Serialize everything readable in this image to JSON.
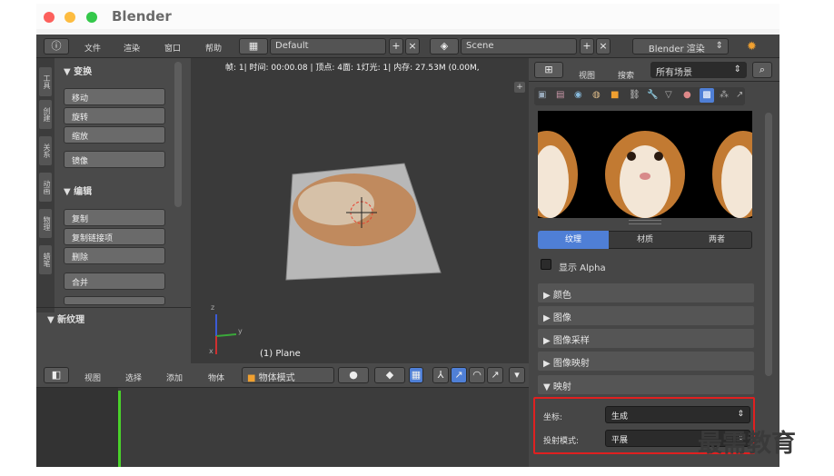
{
  "window": {
    "title": "Blender"
  },
  "infobar": {
    "menus": [
      "文件",
      "渲染",
      "窗口",
      "帮助"
    ],
    "screen_layout": "Default",
    "scene": "Scene",
    "render_engine": "Blender 渲染"
  },
  "toolshelf": {
    "tabs": [
      "工具",
      "创建",
      "关系",
      "动画",
      "物理",
      "蜡笔"
    ],
    "transform_header": "▼ 变换",
    "transform_buttons": [
      "移动",
      "旋转",
      "缩放"
    ],
    "mirror_button": "镜像",
    "edit_header": "▼ 编辑",
    "edit_buttons": [
      "复制",
      "复制链接项",
      "删除"
    ],
    "join_button": "合并",
    "new_texture_header": "▼ 新纹理"
  },
  "viewport": {
    "info": "帧: 1| 时间: 00:00.08 | 顶点: 4面: 1灯光: 1| 内存: 27.53M (0.00M,",
    "object_label": "(1) Plane",
    "axis_labels": {
      "z": "z",
      "y": "y",
      "x": "x"
    }
  },
  "timeline_header": {
    "menus": [
      "视图",
      "选择",
      "添加",
      "物体"
    ],
    "mode": "物体模式"
  },
  "properties": {
    "view_menu": "视图",
    "search_label": "搜索",
    "filter": "所有场景",
    "tabs": [
      "纹理",
      "材质",
      "两者"
    ],
    "show_alpha": "显示 Alpha",
    "sections": [
      "▶ 颜色",
      "▶ 图像",
      "▶ 图像采样",
      "▶ 图像映射"
    ],
    "mapping_header": "▼ 映射",
    "coordinates_label": "坐标:",
    "coordinates_value": "生成",
    "projection_label": "投射模式:",
    "projection_value": "平展"
  },
  "watermark": "最需教育",
  "colors": {
    "accent_blue": "#4f7fd6",
    "highlight_red": "#e02020",
    "timeline_green": "#4ad12a"
  }
}
